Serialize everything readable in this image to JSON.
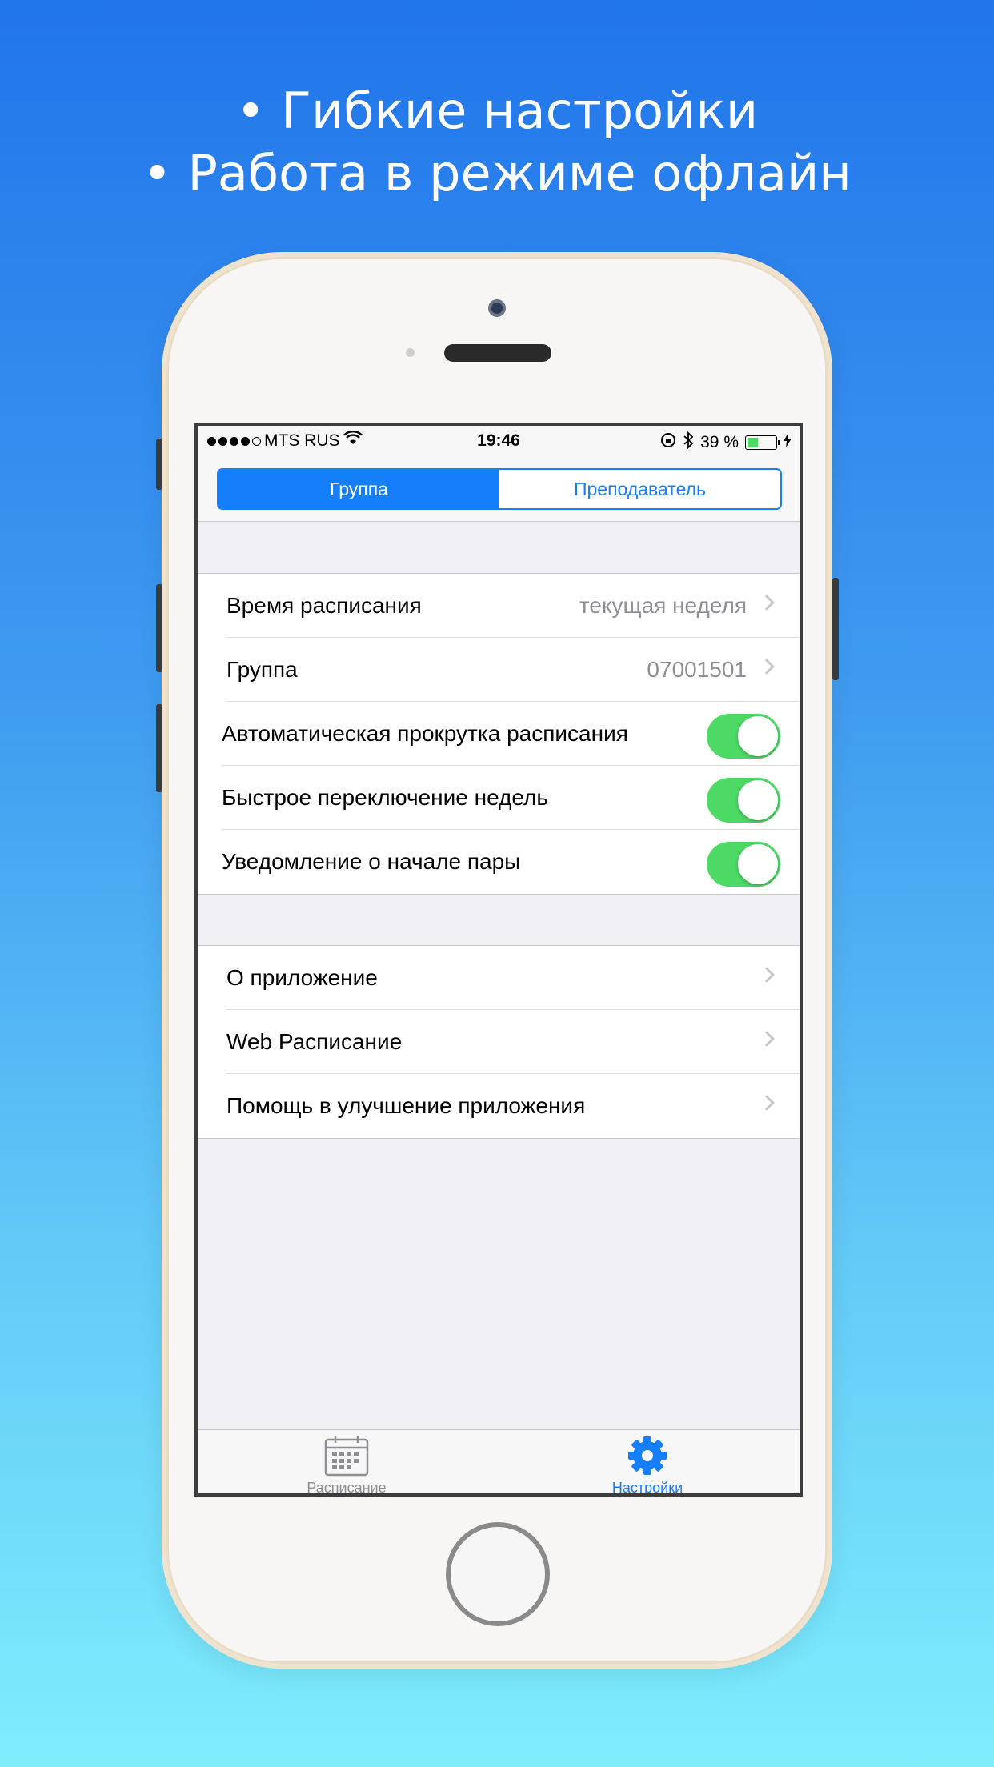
{
  "headline": {
    "line1": "• Гибкие настройки",
    "line2": "• Работа в режиме офлайн"
  },
  "status_bar": {
    "carrier": "MTS RUS",
    "time": "19:46",
    "battery_text": "39 %",
    "battery_level": 0.39
  },
  "segmented": {
    "active": "Группа",
    "inactive": "Преподаватель"
  },
  "settings_group_1": [
    {
      "label": "Время расписания",
      "value": "текущая неделя",
      "type": "disclosure"
    },
    {
      "label": "Группа",
      "value": "07001501",
      "type": "disclosure"
    },
    {
      "label": "Автоматическая прокрутка расписания",
      "type": "toggle",
      "on": true
    },
    {
      "label": "Быстрое переключение недель",
      "type": "toggle",
      "on": true
    },
    {
      "label": "Уведомление о начале пары",
      "type": "toggle",
      "on": true
    }
  ],
  "settings_group_2": [
    {
      "label": "О приложение"
    },
    {
      "label": "Web Расписание"
    },
    {
      "label": "Помощь в улучшение приложения"
    }
  ],
  "tabbar": {
    "schedule": "Расписание",
    "settings": "Настройки"
  },
  "colors": {
    "accent": "#147efb",
    "toggle_on": "#4cd964",
    "inactive_tab": "#8e8e93"
  }
}
